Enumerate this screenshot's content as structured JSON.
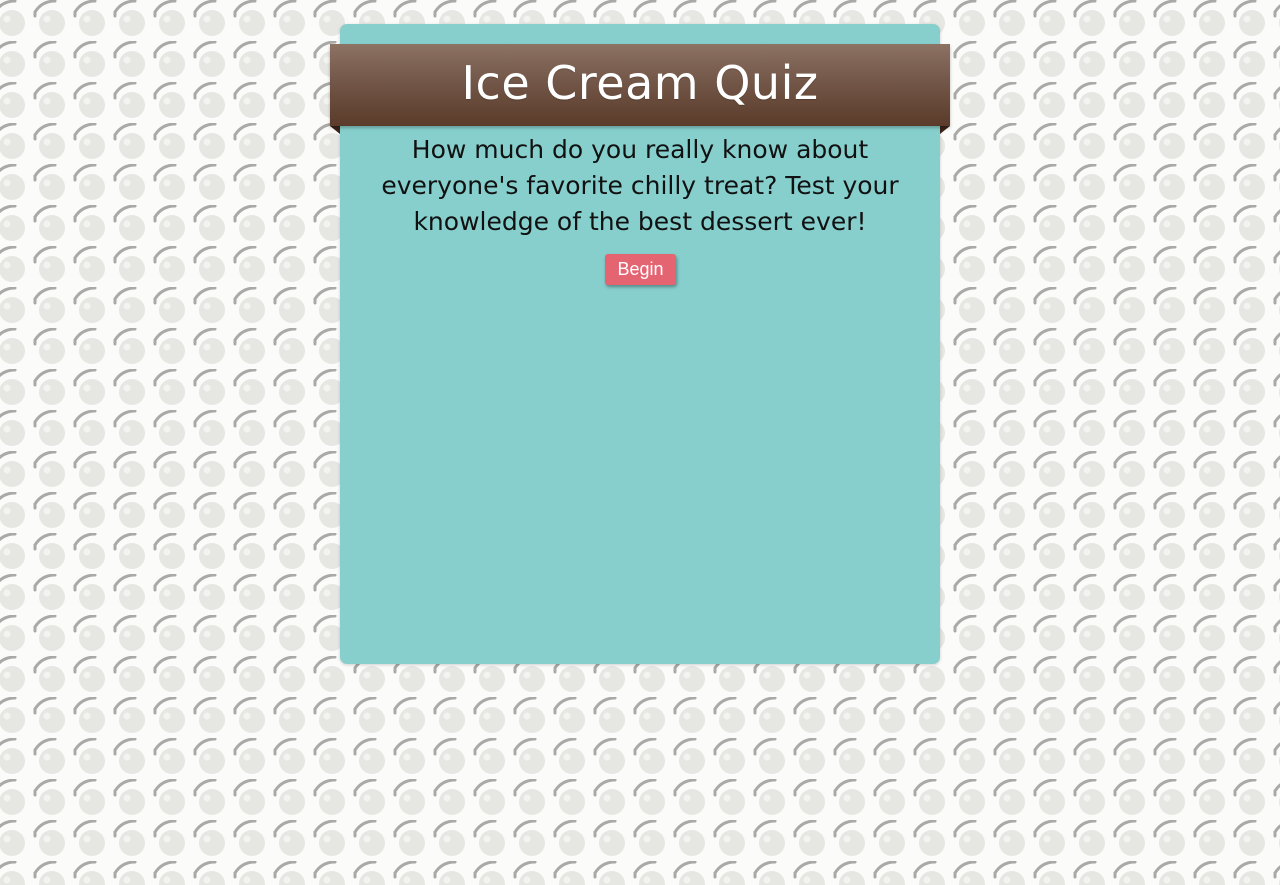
{
  "page": {
    "background_pattern_icon": "cherry-icon"
  },
  "quiz": {
    "title": "Ice Cream Quiz",
    "intro": "How much do you really know about everyone's favorite chilly treat? Test your knowledge of the best dessert ever!",
    "begin_label": "Begin"
  },
  "colors": {
    "card": "#86cfcd",
    "ribbon_top": "#8d7364",
    "ribbon_bottom": "#5b3b2a",
    "button": "#e46472",
    "page_background": "#fbfbfa"
  }
}
